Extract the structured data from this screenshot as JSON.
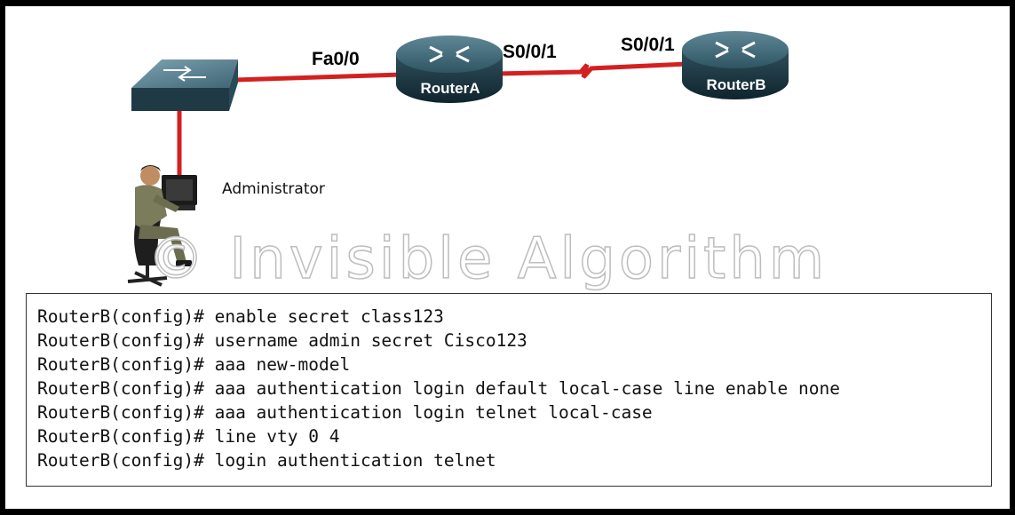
{
  "topology": {
    "switch": {
      "icon": "switch-icon"
    },
    "router_a": {
      "name": "RouterA",
      "icon": "router-icon"
    },
    "router_b": {
      "name": "RouterB",
      "icon": "router-icon"
    },
    "admin": {
      "label": "Administrator",
      "icon": "admin-workstation-icon"
    },
    "interfaces": {
      "switch_to_router_a": "Fa0/0",
      "router_a_serial": "S0/0/1",
      "router_b_serial": "S0/0/1"
    },
    "link_color": "#d42020"
  },
  "watermark": "© Invisible Algorithm",
  "cli": {
    "prompt": "RouterB(config)#",
    "commands": [
      "enable secret class123",
      "username admin secret Cisco123",
      "aaa new-model",
      "aaa authentication login default local-case line enable none",
      "aaa authentication login telnet local-case",
      "line vty 0 4",
      "login authentication telnet"
    ]
  }
}
